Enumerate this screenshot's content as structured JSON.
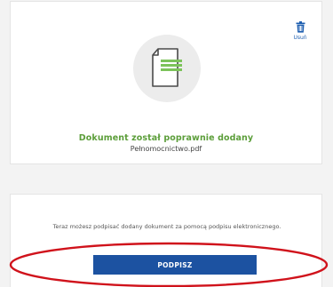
{
  "upload_card": {
    "delete_label": "Usuń",
    "status_message": "Dokument został poprawnie dodany",
    "file_name": "Pełnomocnictwo.pdf"
  },
  "sign_card": {
    "info_text": "Teraz możesz podpisać dodany dokument za pomocą podpisu elektronicznego.",
    "sign_button_label": "PODPISZ"
  },
  "icons": {
    "delete": "trash-icon",
    "document": "document-icon"
  },
  "colors": {
    "success": "#5c9e3a",
    "primary": "#1c52a1",
    "highlight": "#d0121b",
    "link": "#1f5fb0"
  }
}
